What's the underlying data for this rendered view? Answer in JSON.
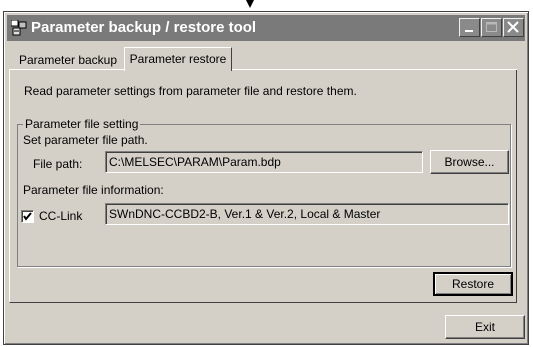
{
  "window": {
    "title": "Parameter backup / restore tool",
    "controls": [
      "minimize-icon",
      "maximize-icon",
      "close-icon"
    ]
  },
  "tabs": [
    {
      "label": "Parameter backup",
      "active": false
    },
    {
      "label": "Parameter restore",
      "active": true
    }
  ],
  "main": {
    "description": "Read parameter settings from parameter file and restore them.",
    "group": {
      "legend": "Parameter file setting",
      "set_path_label": "Set parameter file path.",
      "file_path_label": "File path:",
      "file_path_value": "C:\\MELSEC\\PARAM\\Param.bdp",
      "browse_label": "Browse...",
      "info_label": "Parameter file information:",
      "cclink_label": "CC-Link",
      "cclink_checked": true,
      "cclink_info": "SWnDNC-CCBD2-B, Ver.1 & Ver.2, Local & Master"
    },
    "restore_label": "Restore"
  },
  "footer": {
    "exit_label": "Exit"
  },
  "colors": {
    "window_bg": "#d4d0c8",
    "titlebar_bg": "#7a7a7a",
    "title_text": "#ffffff"
  }
}
